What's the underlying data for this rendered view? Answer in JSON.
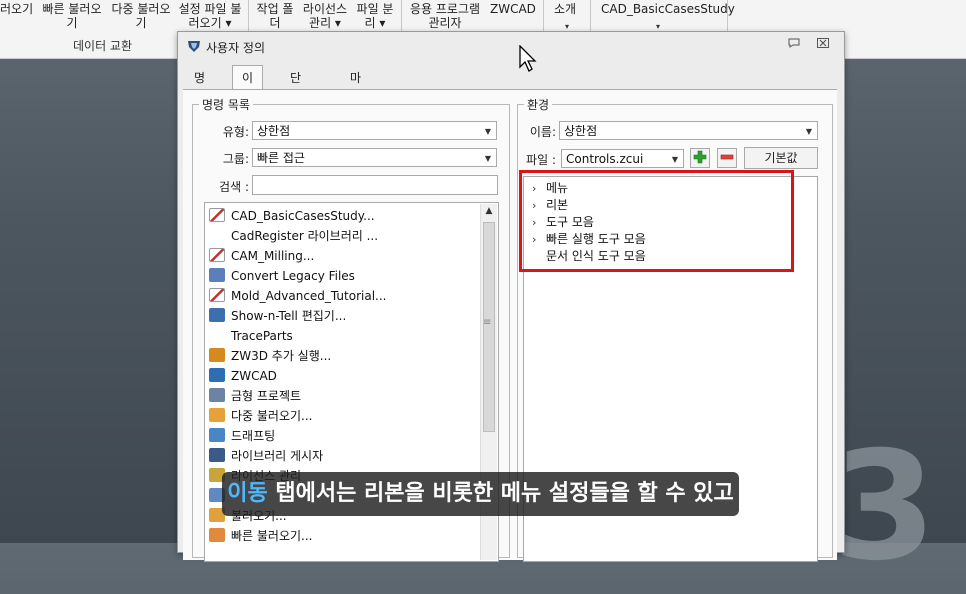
{
  "ribbon": {
    "items": [
      {
        "label": "러오기"
      },
      {
        "label": "빠른 불러오\n기"
      },
      {
        "label": "다중 불러오\n기"
      },
      {
        "label": "설정 파일 불\n러오기 ▾"
      },
      {
        "label": "작업 폴\n더"
      },
      {
        "label": "라이선스\n관리 ▾"
      },
      {
        "label": "파일 분\n리 ▾"
      },
      {
        "label": "응용 프로그램\n관리자"
      },
      {
        "label": "ZWCAD"
      },
      {
        "label": "소개"
      },
      {
        "label": "CAD_BasicCasesStudy"
      }
    ],
    "group_label": "데이터 교환"
  },
  "dialog": {
    "title": "사용자 정의",
    "tabs": [
      {
        "label": "명령"
      },
      {
        "label": "이동"
      },
      {
        "label": "단축키"
      },
      {
        "label": "마우스"
      }
    ],
    "left": {
      "legend": "명령 목록",
      "type_label": "유형:",
      "type_value": "상한점",
      "group_label": "그룹:",
      "group_value": "빠른 접근",
      "search_label": "검색 :",
      "search_value": "",
      "commands": [
        {
          "label": "CAD_BasicCasesStudy...",
          "icon": "pdf-icon"
        },
        {
          "label": "CadRegister 라이브러리 ...",
          "icon": ""
        },
        {
          "label": "CAM_Milling...",
          "icon": "pdf-icon"
        },
        {
          "label": "Convert Legacy Files",
          "icon": "convert-icon"
        },
        {
          "label": "Mold_Advanced_Tutorial...",
          "icon": "pdf-icon"
        },
        {
          "label": "Show-n-Tell 편집기...",
          "icon": "shownt-icon"
        },
        {
          "label": "TraceParts",
          "icon": ""
        },
        {
          "label": "ZW3D 추가 실행...",
          "icon": "zw3d-icon"
        },
        {
          "label": "ZWCAD",
          "icon": "zwcad-icon"
        },
        {
          "label": "금형 프로젝트",
          "icon": "mold-project-icon"
        },
        {
          "label": "다중 불러오기...",
          "icon": "multi-open-icon"
        },
        {
          "label": "드래프팅",
          "icon": "drafting-icon"
        },
        {
          "label": "라이브러리 게시자",
          "icon": "library-publisher-icon"
        },
        {
          "label": "라이선스 관리",
          "icon": "license-icon"
        },
        {
          "label": "",
          "icon": "generic-icon"
        },
        {
          "label": "불러오기...",
          "icon": "open-icon"
        },
        {
          "label": "빠른 불러오기...",
          "icon": "quick-open-icon"
        }
      ]
    },
    "right": {
      "legend": "환경",
      "name_label": "이름:",
      "name_value": "상한점",
      "file_label": "파일 :",
      "file_value": "Controls.zcui",
      "add_icon": "plus-icon",
      "remove_icon": "minus-icon",
      "default_button": "기본값",
      "tree": [
        {
          "label": "메뉴",
          "expandable": true
        },
        {
          "label": "리본",
          "expandable": true
        },
        {
          "label": "도구 모음",
          "expandable": true
        },
        {
          "label": "빠른 실행 도구 모음",
          "expandable": true
        },
        {
          "label": "문서 인식 도구 모음",
          "expandable": false
        }
      ]
    }
  },
  "caption": {
    "highlight": "이동",
    "rest": " 탭에서는 리본을 비롯한 메뉴 설정들을 할 수 있고"
  },
  "colors": {
    "highlight_box": "#d9151c",
    "caption_accent": "#4db8ff"
  }
}
